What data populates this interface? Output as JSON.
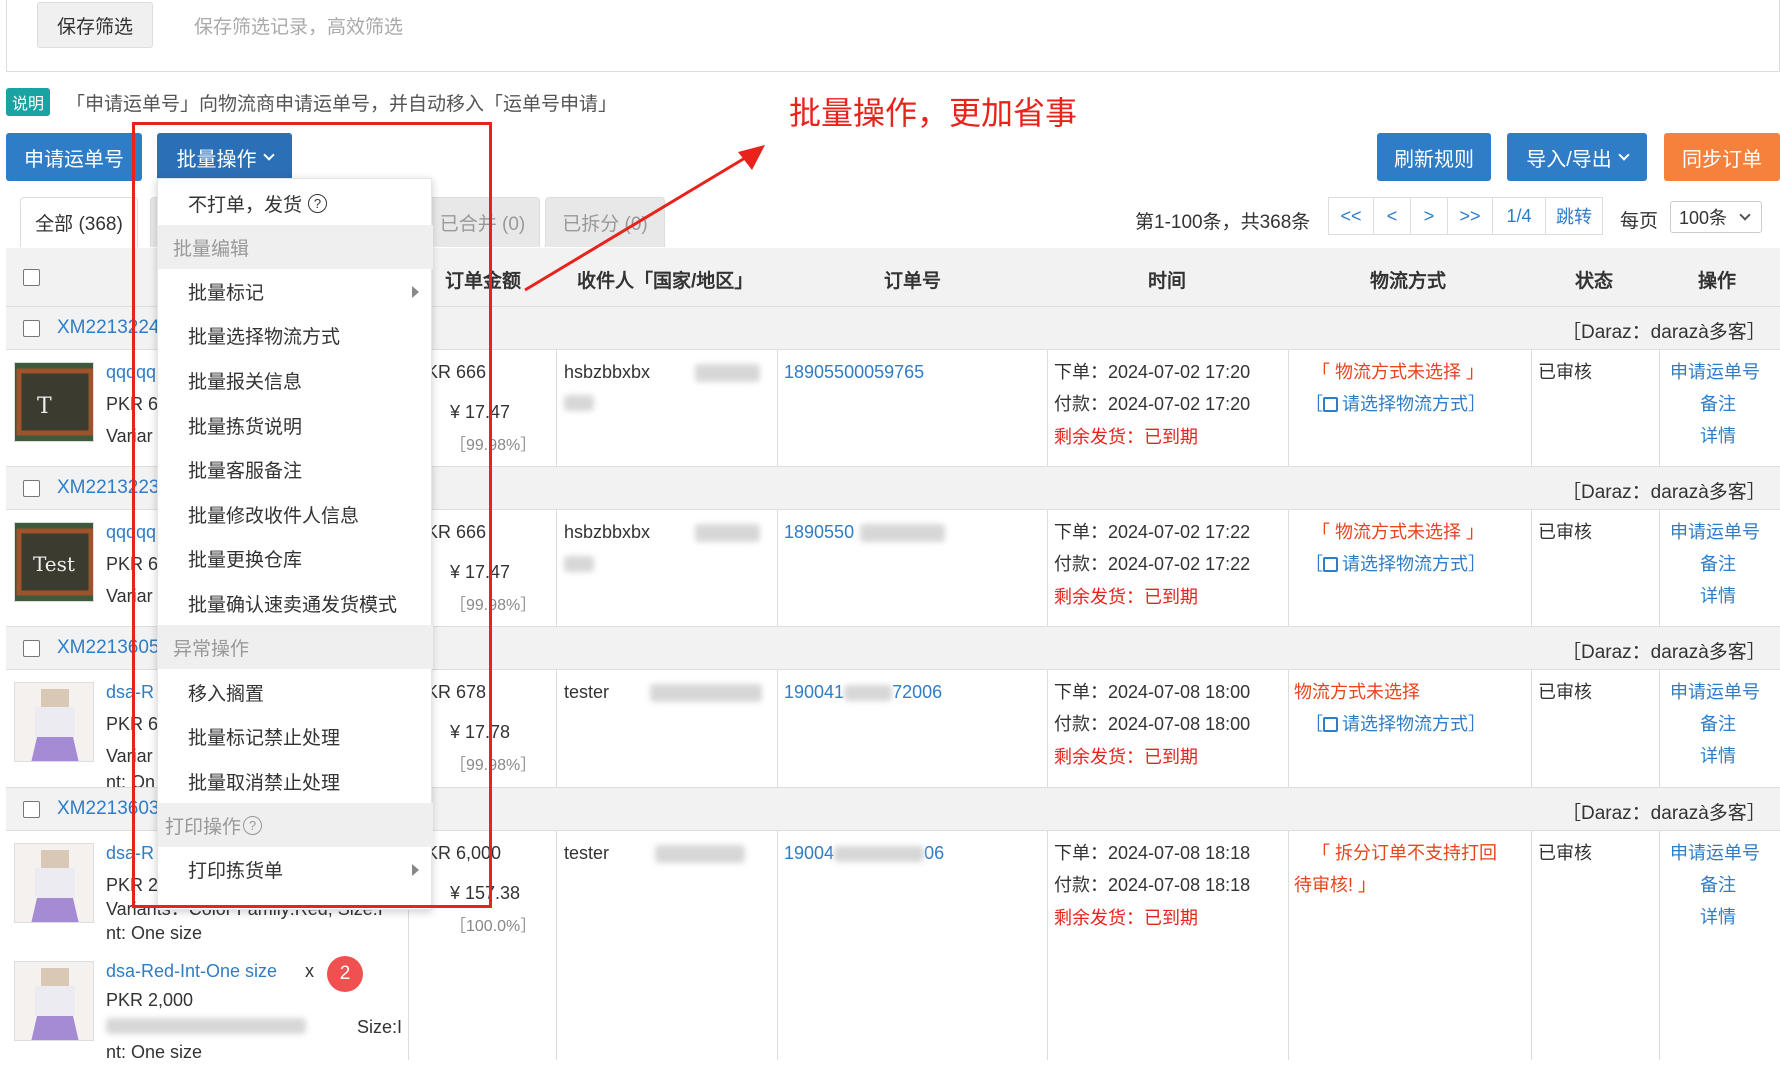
{
  "top": {
    "save_filter_label": "保存筛选",
    "save_filter_hint": "保存筛选记录，高效筛选"
  },
  "info": {
    "badge": "说明",
    "text": "「申请运单号」向物流商申请运单号，并自动移入「运单号申请」"
  },
  "annotation": "批量操作，更加省事",
  "toolbar": {
    "apply_waybill": "申请运单号",
    "batch_ops": "批量操作",
    "refresh_rules": "刷新规则",
    "import_export": "导入/导出",
    "sync_orders": "同步订单"
  },
  "tabs": {
    "all": "全部 (368)",
    "merged": "已合并 (0)",
    "split": "已拆分 (0)"
  },
  "pagination": {
    "summary": "第1-100条，共368条",
    "first": "<<",
    "prev": "<",
    "next": ">",
    "last": ">>",
    "current": "1/4",
    "jump": "跳转",
    "per_page_label": "每页",
    "per_page_value": "100条"
  },
  "headers": {
    "amount": "订单金额",
    "receiver": "收件人「国家/地区」",
    "order_no": "订单号",
    "time": "时间",
    "logistics": "物流方式",
    "status": "状态",
    "actions": "操作"
  },
  "dropdown": {
    "item_no_print_ship": "不打单，发货",
    "group_batch_edit": "批量编辑",
    "item_batch_mark": "批量标记",
    "item_batch_logistics": "批量选择物流方式",
    "item_batch_customs": "批量报关信息",
    "item_batch_picking_note": "批量拣货说明",
    "item_batch_cs_note": "批量客服备注",
    "item_batch_receiver": "批量修改收件人信息",
    "item_batch_warehouse": "批量更换仓库",
    "item_batch_confirm_mode": "批量确认速卖通发货模式",
    "group_exception": "异常操作",
    "item_move_hold": "移入搁置",
    "item_mark_forbid": "批量标记禁止处理",
    "item_cancel_forbid": "批量取消禁止处理",
    "group_print": "打印操作",
    "item_print_picking": "打印拣货单"
  },
  "orders": [
    {
      "order_id": "XM2213224",
      "store": "［Daraz：darazà多客］",
      "product_name": "qqqqq",
      "product_price": "PKR 6",
      "product_variant": "Variar",
      "amount": "KR 666",
      "amount_rmb": "¥ 17.47",
      "amount_pct": "［99.98%］",
      "receiver": "hsbzbbxbx",
      "order_no": "18905500059765",
      "time_order": "下单：2024-07-02 17:20",
      "time_pay": "付款：2024-07-02 17:20",
      "time_remaining": "剩余发货：已到期",
      "logistics_warn": "「 物流方式未选择 」",
      "logistics_select": "请选择物流方式",
      "status": "已审核",
      "action_apply": "申请运单号",
      "action_note": "备注",
      "action_detail": "详情"
    },
    {
      "order_id": "XM2213223",
      "store": "［Daraz：darazà多客］",
      "product_name": "qqqqq",
      "product_price": "PKR 6",
      "product_variant": "Variar",
      "amount": "KR 666",
      "amount_rmb": "¥ 17.47",
      "amount_pct": "［99.98%］",
      "receiver": "hsbzbbxbx",
      "order_no": "1890550",
      "time_order": "下单：2024-07-02 17:22",
      "time_pay": "付款：2024-07-02 17:22",
      "time_remaining": "剩余发货：已到期",
      "logistics_warn": "「 物流方式未选择 」",
      "logistics_select": "请选择物流方式",
      "status": "已审核",
      "action_apply": "申请运单号",
      "action_note": "备注",
      "action_detail": "详情"
    },
    {
      "order_id": "XM2213605",
      "store": "［Daraz：darazà多客］",
      "product_name": "dsa-R",
      "product_price": "PKR 6",
      "product_variant": "Variar",
      "product_extra": "nt: On",
      "amount": "KR 678",
      "amount_rmb": "¥ 17.78",
      "amount_pct": "［99.98%］",
      "receiver": "tester",
      "order_no": "190041",
      "order_no_tail": "72006",
      "time_order": "下单：2024-07-08 18:00",
      "time_pay": "付款：2024-07-08 18:00",
      "time_remaining": "剩余发货：已到期",
      "logistics_warn": "物流方式未选择",
      "logistics_select": "请选择物流方式",
      "status": "已审核",
      "action_apply": "申请运单号",
      "action_note": "备注",
      "action_detail": "详情"
    },
    {
      "order_id": "XM2213603",
      "store": "［Daraz：darazà多客］",
      "product_name": "dsa-R",
      "product_price": "PKR 2",
      "product_variant": "Variants：Color Family:Red, Size:I",
      "product_extra": "nt: One size",
      "product2_name": "dsa-Red-Int-One size",
      "product2_qty": "x",
      "product2_qty_badge": "2",
      "product2_price": "PKR 2,000",
      "product2_variant_tail": "Size:I",
      "product2_extra": "nt: One size",
      "amount": "KR 6,000",
      "amount_rmb": "¥ 157.38",
      "amount_pct": "［100.0%］",
      "receiver": "tester",
      "order_no": "19004",
      "order_no_tail": "06",
      "time_order": "下单：2024-07-08 18:18",
      "time_pay": "付款：2024-07-08 18:18",
      "time_remaining": "剩余发货：已到期",
      "logistics_warn": "「 拆分订单不支持打回",
      "logistics_warn2": "待审核! 」",
      "status": "已审核",
      "action_apply": "申请运单号",
      "action_note": "备注",
      "action_detail": "详情"
    }
  ]
}
